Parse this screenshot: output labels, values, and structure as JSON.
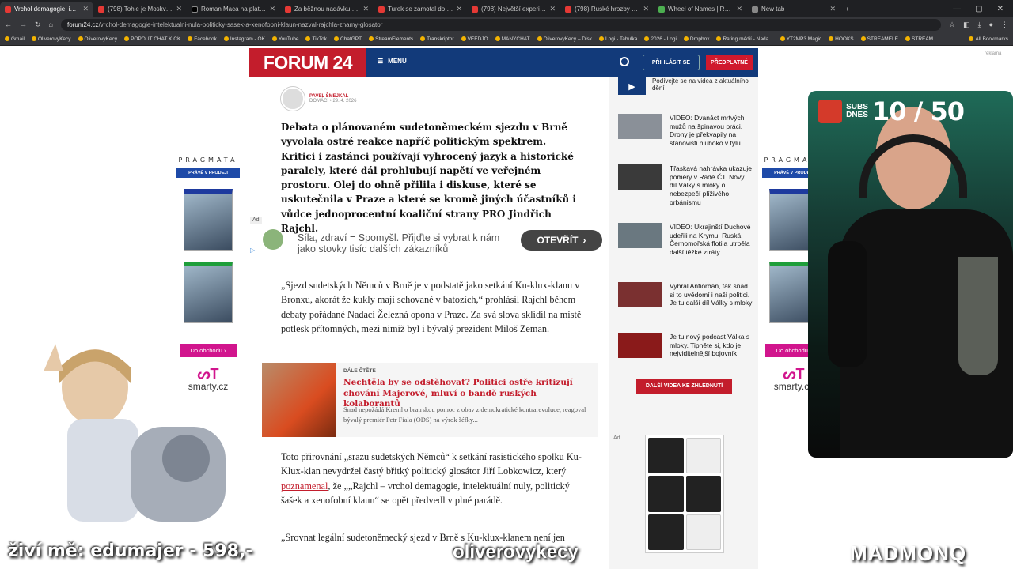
{
  "browser": {
    "tabs": [
      {
        "label": "Vrchol demagogie, intelektuáln",
        "active": true,
        "icon": "forum24-favicon"
      },
      {
        "label": "(798) Tohle je Moskva v dubnu",
        "icon": "youtube-favicon"
      },
      {
        "label": "Roman Maca na platformě X: \"",
        "icon": "x-favicon"
      },
      {
        "label": "Za běžnou nadávku si Turek vy",
        "icon": "youtube-favicon"
      },
      {
        "label": "Turek se zamotal do vlastních l",
        "icon": "youtube-favicon"
      },
      {
        "label": "(798) Největší experiment s čes",
        "icon": "youtube-favicon"
      },
      {
        "label": "(798) Ruské hrozby českým zbr",
        "icon": "youtube-favicon"
      },
      {
        "label": "Wheel of Names | Random nam",
        "icon": "wheel-favicon"
      },
      {
        "label": "New tab",
        "icon": "newtab-favicon"
      }
    ],
    "url_domain": "forum24.cz",
    "url_path": "/vrchol-demagogie-intelektualni-nula-politicky-sasek-a-xenofobni-klaun-nazval-rajchla-znamy-glosator",
    "bookmarks": [
      "Gmail",
      "OliverovyKecy",
      "OliverovyKecy",
      "POPOUT CHAT KICK",
      "Facebook",
      "Instagram - OK",
      "YouTube",
      "TikTok",
      "ChatGPT",
      "StreamElements",
      "Transkriptor",
      "VEEDJO",
      "MANYCHAT",
      "OliverovyKecy – Disk",
      "Logi - Tabulka",
      "2026 - Logi",
      "Dropbox",
      "Rating médií - Nada...",
      "YT2MP3 Magic",
      "HOOKS",
      "STREAMELE",
      "STREAM",
      "All Bookmarks"
    ]
  },
  "site": {
    "logo": "FORUM 24",
    "menu_label": "MENU",
    "login_label": "PŘIHLÁSIT SE",
    "subscribe_label": "PŘEDPLATNÉ",
    "ad_marker": "reklama"
  },
  "article": {
    "author": "PAVEL ŠMEJKAL",
    "section": "DOMÁCÍ",
    "date": "29. 4. 2026",
    "lead": "Debata o plánovaném sudetoněmeckém sjezdu v Brně vyvolala ostré reakce napříč politickým spektrem. Kritici i zastánci používají vyhrocený jazyk a historické paralely, které dál prohlubují napětí ve veřejném prostoru. Olej do ohně přilila i diskuse, které se uskutečnila v Praze a které se kromě jiných účastníků i vůdce jednoprocentní koaliční strany PRO Jindřich Rajchl.",
    "ad": {
      "label": "Ad",
      "text": "Síla, zdraví = Spomyšl. Přijďte si vybrat k nám jako stovky tisíc dalších zákazníků",
      "button": "OTEVŘÍT"
    },
    "paragraph1": "„Sjezd sudetských Němců v Brně je v podstatě jako setkání Ku-klux-klanu v Bronxu, akorát že kukly mají schované v batozích,“ prohlásil Rajchl během debaty pořádané Nadací Železná opona v Praze. Za svá slova sklidil na místě potlesk přítomných, mezi nimiž byl i bývalý prezident Miloš Zeman.",
    "related": {
      "tag": "DÁLE ČTĚTE",
      "title": "Nechtěla by se odstěhovat? Politici ostře kritizují chování Majerové, mluví o bandě ruských kolaborantů",
      "desc": "Snad nepožádá Kreml o bratrskou pomoc z obav z demokratické kontrarevoluce, reagoval bývalý premiér Petr Fiala (ODS) na výrok šéfky..."
    },
    "paragraph2_a": "Toto přirovnání „srazu sudetských Němců“ k setkání rasistického spolku Ku-Klux-klan nevydržel častý břitký politický glosátor Jiří Lobkowicz, který ",
    "paragraph2_link": "poznamenal",
    "paragraph2_b": ", že „„Rajchl – vrchol demagogie, intelektuální nuly, politický šašek a xenofobní klaun“ se opět předvedl v plné parádě.",
    "paragraph3": "„Srovnat legální sudetoněmecký sjezd v Brně s Ku-klux-klanem není jen"
  },
  "sidebar": {
    "video_top": "Podívejte se na videa z aktuálního dění",
    "items": [
      "VIDEO: Dvanáct mrtvých mužů na špinavou práci. Drony je překvapily na stanovišti hluboko v týlu",
      "Třaskavá nahrávka ukazuje poměry v Radě ČT. Nový díl Války s mloky o nebezpečí plíživého orbánismu",
      "VIDEO: Ukrajinští Duchové udeřili na Krymu. Ruská Černomořská flotila utrpěla další těžké ztráty",
      "Vyhrál Antiorbán, tak snad si to uvědomí i naši politici. Je tu další díl Války s mloky",
      "Je tu nový podcast Válka s mloky. Tipněte si, kdo je nejviditelnější bojovník"
    ],
    "more_videos": "DALŠÍ VIDEA KE ZHLÉDNUTÍ",
    "ad_label": "Ad"
  },
  "banners": {
    "title": "PRAGMATA",
    "subtitle": "PRÁVĚ V PRODEJI",
    "shop_button": "Do obchodu ›",
    "store": "smarty.cz"
  },
  "stream": {
    "subs_label": "SUBS DNES",
    "subs_count": "10 / 50",
    "donation": "živí mě: edumajer - 598,-",
    "channel": "oliverovykecy",
    "sponsor": "MADMONQ"
  }
}
